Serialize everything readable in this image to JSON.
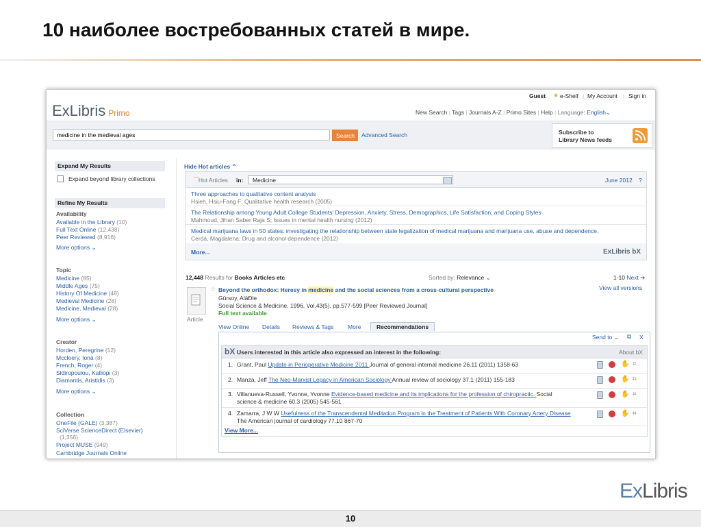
{
  "slide": {
    "title": "10 наиболее востребованных статей в мире.",
    "page_number": "10",
    "corner_logo": {
      "part1": "Ex",
      "part2": "Libris"
    }
  },
  "app": {
    "logo": {
      "part1": "ExLibris",
      "part2": "Primo"
    },
    "top_nav": {
      "guest": "Guest",
      "eshelf": "e-Shelf",
      "my_account": "My Account",
      "sign_in": "Sign in"
    },
    "secondary_nav": [
      "New Search",
      "Tags",
      "Journals A-Z",
      "Primo Sites",
      "Help"
    ],
    "language": {
      "label": "Language:",
      "value": "English"
    },
    "search": {
      "query": "medicine in the medieval ages",
      "button": "Search",
      "advanced": "Advanced Search"
    },
    "rss": {
      "line1": "Subscribe to",
      "line2": "Library News feeds"
    }
  },
  "left_panel": {
    "expand_header": "Expand My Results",
    "expand_option": "Expand beyond library collections",
    "refine_header": "Refine My Results",
    "more_options": "More options",
    "facets": [
      {
        "title": "Availability",
        "items": [
          {
            "label": "Available in the Library",
            "count": "(10)"
          },
          {
            "label": "Full Text Online",
            "count": "(12,438)"
          },
          {
            "label": "Peer Reviewed",
            "count": "(8,916)"
          }
        ]
      },
      {
        "title": "Topic",
        "items": [
          {
            "label": "Medicine",
            "count": "(85)"
          },
          {
            "label": "Middle Ages",
            "count": "(75)"
          },
          {
            "label": "History Of Medicine",
            "count": "(48)"
          },
          {
            "label": "Medieval Medicine",
            "count": "(28)"
          },
          {
            "label": "Medicine, Medieval",
            "count": "(28)"
          }
        ]
      },
      {
        "title": "Creator",
        "items": [
          {
            "label": "Horden, Peregrine",
            "count": "(12)"
          },
          {
            "label": "Mccleery, Iona",
            "count": "(8)"
          },
          {
            "label": "French, Roger",
            "count": "(4)"
          },
          {
            "label": "Sidiropoulou, Kalliopi",
            "count": "(3)"
          },
          {
            "label": "Diamantis, Aristidis",
            "count": "(3)"
          }
        ]
      },
      {
        "title": "Collection",
        "items": [
          {
            "label": "OneFile (GALE)",
            "count": "(3,387)"
          },
          {
            "label": "SciVerse ScienceDirect (Elsevier)",
            "count": "(1,356)"
          },
          {
            "label": "Project MUSE",
            "count": "(949)"
          },
          {
            "label": "Cambridge Journals Online",
            "count": ""
          }
        ]
      }
    ]
  },
  "hot_articles": {
    "hide_label": "Hide Hot articles",
    "logo_label": "Hot Articles",
    "in_label": "in:",
    "subject": "Medicine",
    "date": "June 2012",
    "help": "?",
    "articles": [
      {
        "title": "Three approaches to qualitative content analysis",
        "authors": "Hsieh, Hsiu-Fang F; Qualitative health research (2005)"
      },
      {
        "title": "The Relationship among Young Adult College Students' Depression, Anxiety, Stress, Demographics, Life Satisfaction, and Coping Styles",
        "authors": "Mahmoud, Jihan Saber Raja S; Issues in mental health nursing (2012)"
      },
      {
        "title": "Medical marijuana laws in 50 states: investigating the relationship between state legalization of medical marijuana and marijuana use, abuse and dependence.",
        "authors": "Cerdá, Magdalena; Drug and alcohol dependence (2012)"
      }
    ],
    "more": "More...",
    "bx_logo": "ExLibris bX"
  },
  "results": {
    "count": "12,448",
    "results_for": "Results for",
    "scope": "Books Articles etc",
    "sorted_by": "Sorted by:",
    "sort_value": "Relevance",
    "range": "1-10",
    "next": "Next",
    "view_all_versions": "View all versions",
    "item": {
      "title_pre": "Beyond the orthodox: Heresy in ",
      "title_hl": "medicine",
      "title_post": " and the social sciences from a cross-cultural perspective",
      "author": "Gürsoy, AläÐle",
      "source": "Social Science & Medicine, 1996, Vol.43(5), pp.577-599 [Peer Reviewed Journal]",
      "availability": "Full text available",
      "type": "Article"
    },
    "tabs": [
      "View Online",
      "Details",
      "Reviews & Tags",
      "More",
      "Recommendations"
    ],
    "send_to": "Send to",
    "close": "X"
  },
  "recommendations": {
    "bx_mark": "bX",
    "header": "Users interested in this article also expressed an interest in the following:",
    "about": "About bX",
    "items": [
      {
        "num": "1.",
        "author": "Grant, Paul ",
        "link": "Update in Perioperative Medicine 2011 ",
        "rest": "Journal of general internal medicine 26.11 (2011) 1358-63"
      },
      {
        "num": "2.",
        "author": "Manza, Jeff ",
        "link": "The Neo-Marxist Legacy in American Sociology ",
        "rest": "Annual review of sociology 37.1 (2011) 155-183"
      },
      {
        "num": "3.",
        "author": "Villanueva-Russell, Yvonne, Yvonne ",
        "link": "Evidence-based medicine and its implications for the profession of chiropractic. ",
        "rest": "Social science & medicine 60.3 (2005) 545-561"
      },
      {
        "num": "4.",
        "author": "Zamarra, J W W ",
        "link": "Usefulness of the Transcendental Meditation Program in the Treatment of Patients With Coronary Artery Disease ",
        "rest": "The American journal of cardiology 77.10 867-70"
      }
    ],
    "view_more": "View More..."
  }
}
